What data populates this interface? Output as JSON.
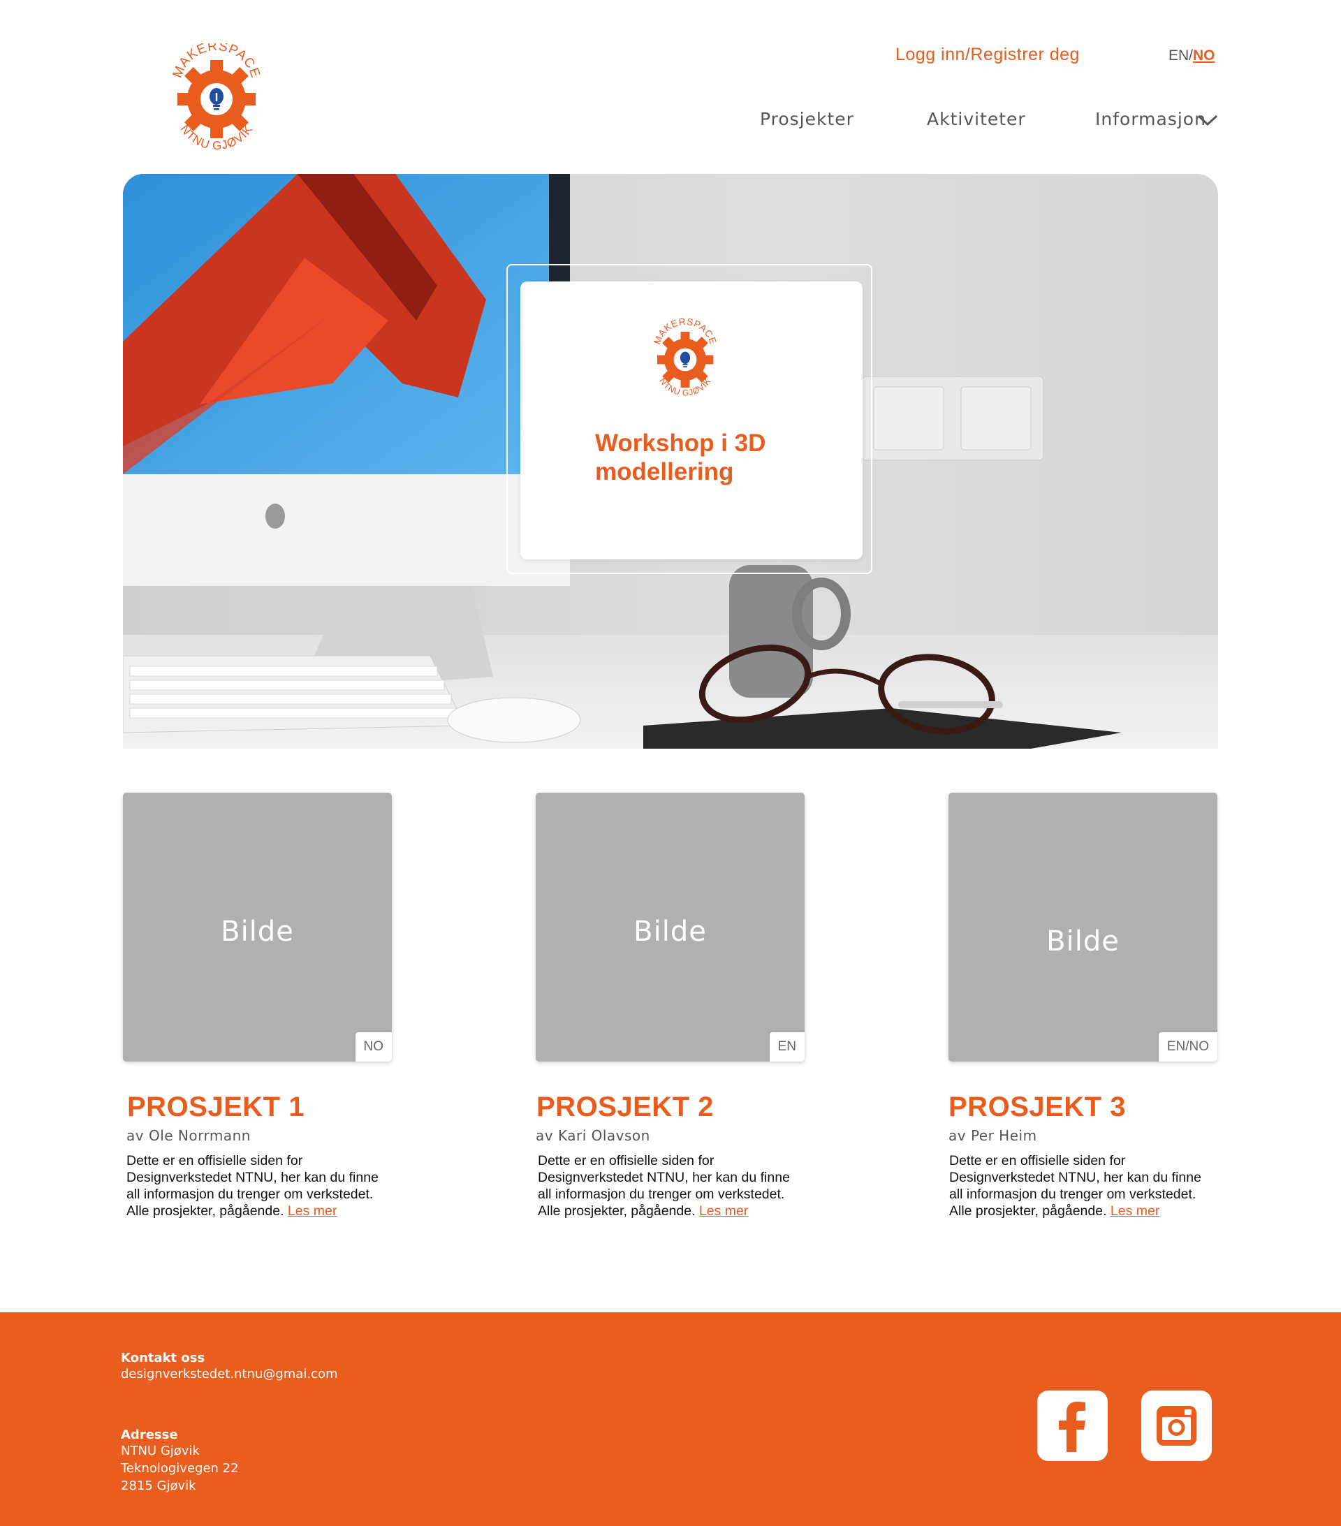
{
  "header": {
    "logo_top_text": "MAKERSPACE",
    "logo_bottom_text": "NTNU GJØVIK",
    "login_label": "Logg inn/Registrer deg",
    "lang_en": "EN/",
    "lang_no": "NO",
    "nav": [
      "Prosjekter",
      "Aktiviteter",
      "Informasjon"
    ]
  },
  "hero": {
    "title_line1": "Workshop i 3D",
    "title_line2": "modellering"
  },
  "projects": [
    {
      "image_placeholder": "Bilde",
      "language_tag": "NO",
      "title": "PROSJEKT 1",
      "author": "av Ole Norrmann",
      "description_lines": [
        "Dette er en offisielle siden for",
        "Designverkstedet NTNU, her kan du finne",
        "all informasjon du trenger om verkstedet.",
        "Alle prosjekter, pågående."
      ],
      "read_more": "Les mer"
    },
    {
      "image_placeholder": "Bilde",
      "language_tag": "EN",
      "title": "PROSJEKT 2",
      "author": "av Kari Olavson",
      "description_lines": [
        "Dette er en offisielle siden for",
        "Designverkstedet NTNU, her kan du finne",
        "all informasjon du trenger om verkstedet.",
        "Alle prosjekter, pågående."
      ],
      "read_more": "Les mer"
    },
    {
      "image_placeholder": "Bilde",
      "language_tag": "EN/NO",
      "title": "PROSJEKT 3",
      "author": "av Per Heim",
      "description_lines": [
        "Dette er en offisielle siden for",
        "Designverkstedet NTNU, her kan du finne",
        "all informasjon du trenger om verkstedet.",
        "Alle prosjekter, pågående."
      ],
      "read_more": "Les mer"
    }
  ],
  "footer": {
    "contact_heading": "Kontakt oss",
    "contact_email": "designverkstedet.ntnu@gmai.com",
    "address_heading": "Adresse",
    "address_lines": [
      "NTNU Gjøvik",
      "Teknologivegen 22",
      "2815 Gjøvik"
    ],
    "social": [
      "facebook-icon",
      "instagram-icon"
    ]
  },
  "colors": {
    "accent": "#e85c1e",
    "footer_bg": "#e95d1e",
    "placeholder_gray": "#b0b0b0",
    "logo_bulb_blue": "#1f4e9e"
  }
}
